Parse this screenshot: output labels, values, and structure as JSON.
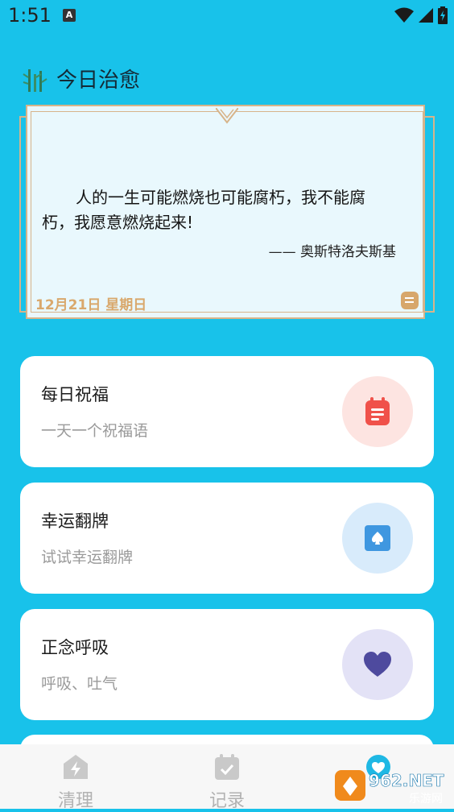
{
  "status_bar": {
    "time": "1:51",
    "notification_icon": "A",
    "icons": [
      "wifi-icon",
      "cell-signal-icon",
      "battery-icon"
    ]
  },
  "header": {
    "title": "今日治愈",
    "logo_icon": "bamboo-icon"
  },
  "quote": {
    "text": "人的一生可能燃烧也可能腐朽，我不能腐朽，我愿意燃烧起来!",
    "author": "—— 奥斯特洛夫斯基",
    "date": "12月21日 星期日",
    "note_icon": "note-icon"
  },
  "features": [
    {
      "title": "每日祝福",
      "subtitle": "一天一个祝福语",
      "icon": "notepad-icon",
      "icon_color": "#f0514a",
      "circle_color": "#fde4e1"
    },
    {
      "title": "幸运翻牌",
      "subtitle": "试试幸运翻牌",
      "icon": "spade-card-icon",
      "icon_color": "#3f97e0",
      "circle_color": "#d8ebfb"
    },
    {
      "title": "正念呼吸",
      "subtitle": "呼吸、吐气",
      "icon": "heart-icon",
      "icon_color": "#4e4a9e",
      "circle_color": "#e3e2f6"
    }
  ],
  "bottom_nav": {
    "items": [
      {
        "label": "清理",
        "icon": "lightning-house-icon"
      },
      {
        "label": "记录",
        "icon": "calendar-check-icon"
      },
      {
        "label": "",
        "icon": "heart-bubble-icon",
        "active": true
      }
    ]
  },
  "watermark": {
    "text": "962.NET",
    "subtext": "乐游网"
  },
  "colors": {
    "background": "#18c2ea",
    "accent_gold": "#d9a86c"
  }
}
